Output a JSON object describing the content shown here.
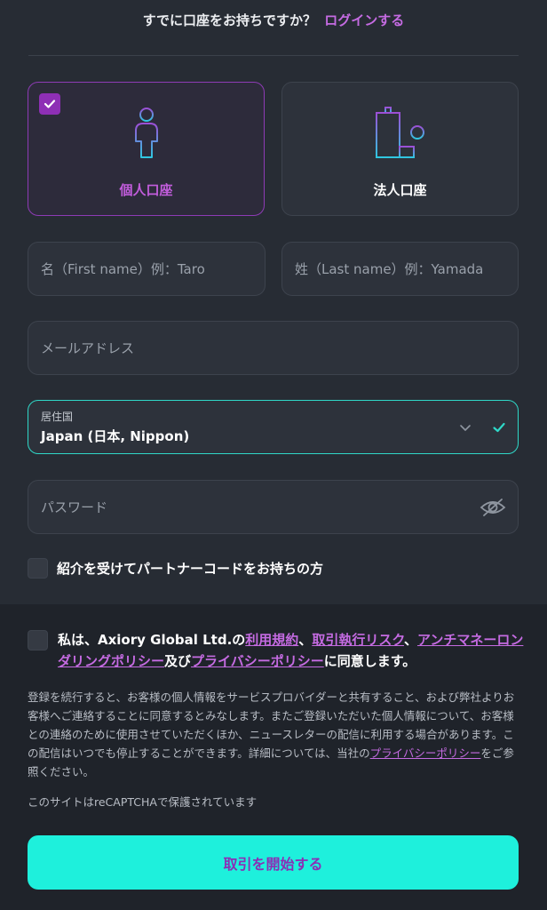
{
  "header": {
    "question": "すでに口座をお持ちですか？",
    "login_link": "ログインする"
  },
  "account_type": {
    "personal_label": "個人口座",
    "corporate_label": "法人口座",
    "selected": "personal"
  },
  "form": {
    "first_name_placeholder": "名（First name）例：Taro",
    "last_name_placeholder": "姓（Last name）例：Yamada",
    "email_placeholder": "メールアドレス",
    "country_label": "居住国",
    "country_value": "Japan (日本, Nippon)",
    "password_placeholder": "パスワード",
    "partner_code_label": "紹介を受けてパートナーコードをお持ちの方"
  },
  "agreement": {
    "prefix": "私は、Axiory Global Ltd.の",
    "terms_link": "利用規約",
    "sep1": "、",
    "risk_link": "取引執行リスク",
    "sep2": "、",
    "aml_link": "アンチマネーロンダリングポリシー",
    "and": "及び",
    "privacy_link": "プライバシーポリシー",
    "suffix": "に同意します。"
  },
  "notice": {
    "text_before": "登録を続行すると、お客様の個人情報をサービスプロバイダーと共有すること、および弊社よりお客様へご連絡することに同意するとみなします。またご登録いただいた個人情報について、お客様との連絡のために使用させていただくほか、ニュースレターの配信に利用する場合があります。この配信はいつでも停止することができます。詳細については、当社の",
    "privacy_link": "プライバシーポリシー",
    "text_after": "をご参照ください。"
  },
  "recaptcha_text": "このサイトはreCAPTCHAで保護されています",
  "submit_label": "取引を開始する",
  "colors": {
    "accent_purple": "#c56be2",
    "accent_cyan": "#1ef0dc",
    "background": "#272c34"
  },
  "icons": {
    "check": "check-icon",
    "person": "person-icon",
    "building": "building-icon",
    "chevron": "chevron-down-icon",
    "eye": "eye-off-icon"
  }
}
